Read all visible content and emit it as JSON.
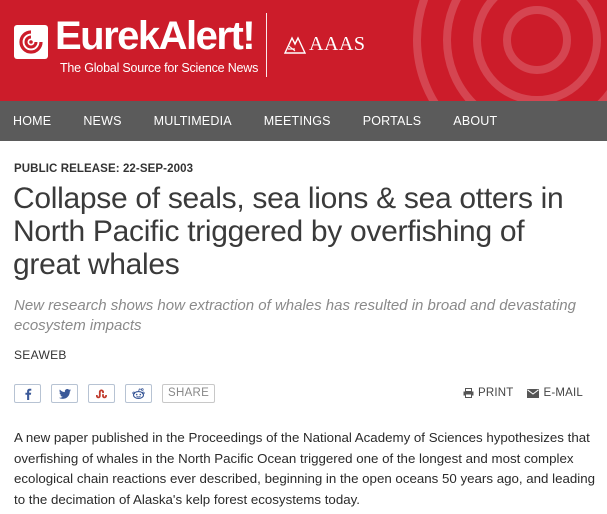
{
  "header": {
    "logo_text": "EurekAlert!",
    "tagline": "The Global Source for Science News",
    "partner": "AAAS",
    "brand_color": "#cc1c2a"
  },
  "nav": {
    "items": [
      "HOME",
      "NEWS",
      "MULTIMEDIA",
      "MEETINGS",
      "PORTALS",
      "ABOUT"
    ],
    "background": "#5b5b5b"
  },
  "article": {
    "release": "PUBLIC RELEASE: 22-SEP-2003",
    "headline": "Collapse of seals, sea lions & sea otters in North Pacific triggered by overfishing of great whales",
    "subhead": "New research shows how extraction of whales has resulted in broad and devastating ecosystem impacts",
    "source": "SEAWEB",
    "body": "A new paper published in the Proceedings of the National Academy of Sciences hypothesizes that overfishing of whales in the North Pacific Ocean triggered one of the longest and most complex ecological chain reactions ever described, beginning in the open oceans 50 years ago, and leading to the decimation of Alaska's kelp forest ecosystems today."
  },
  "share": {
    "icons": [
      "facebook-icon",
      "twitter-icon",
      "stumbleupon-icon",
      "reddit-icon"
    ],
    "label": "SHARE",
    "icon_color": "#3b5998"
  },
  "tools": {
    "print_label": "PRINT",
    "email_label": "E-MAIL"
  }
}
